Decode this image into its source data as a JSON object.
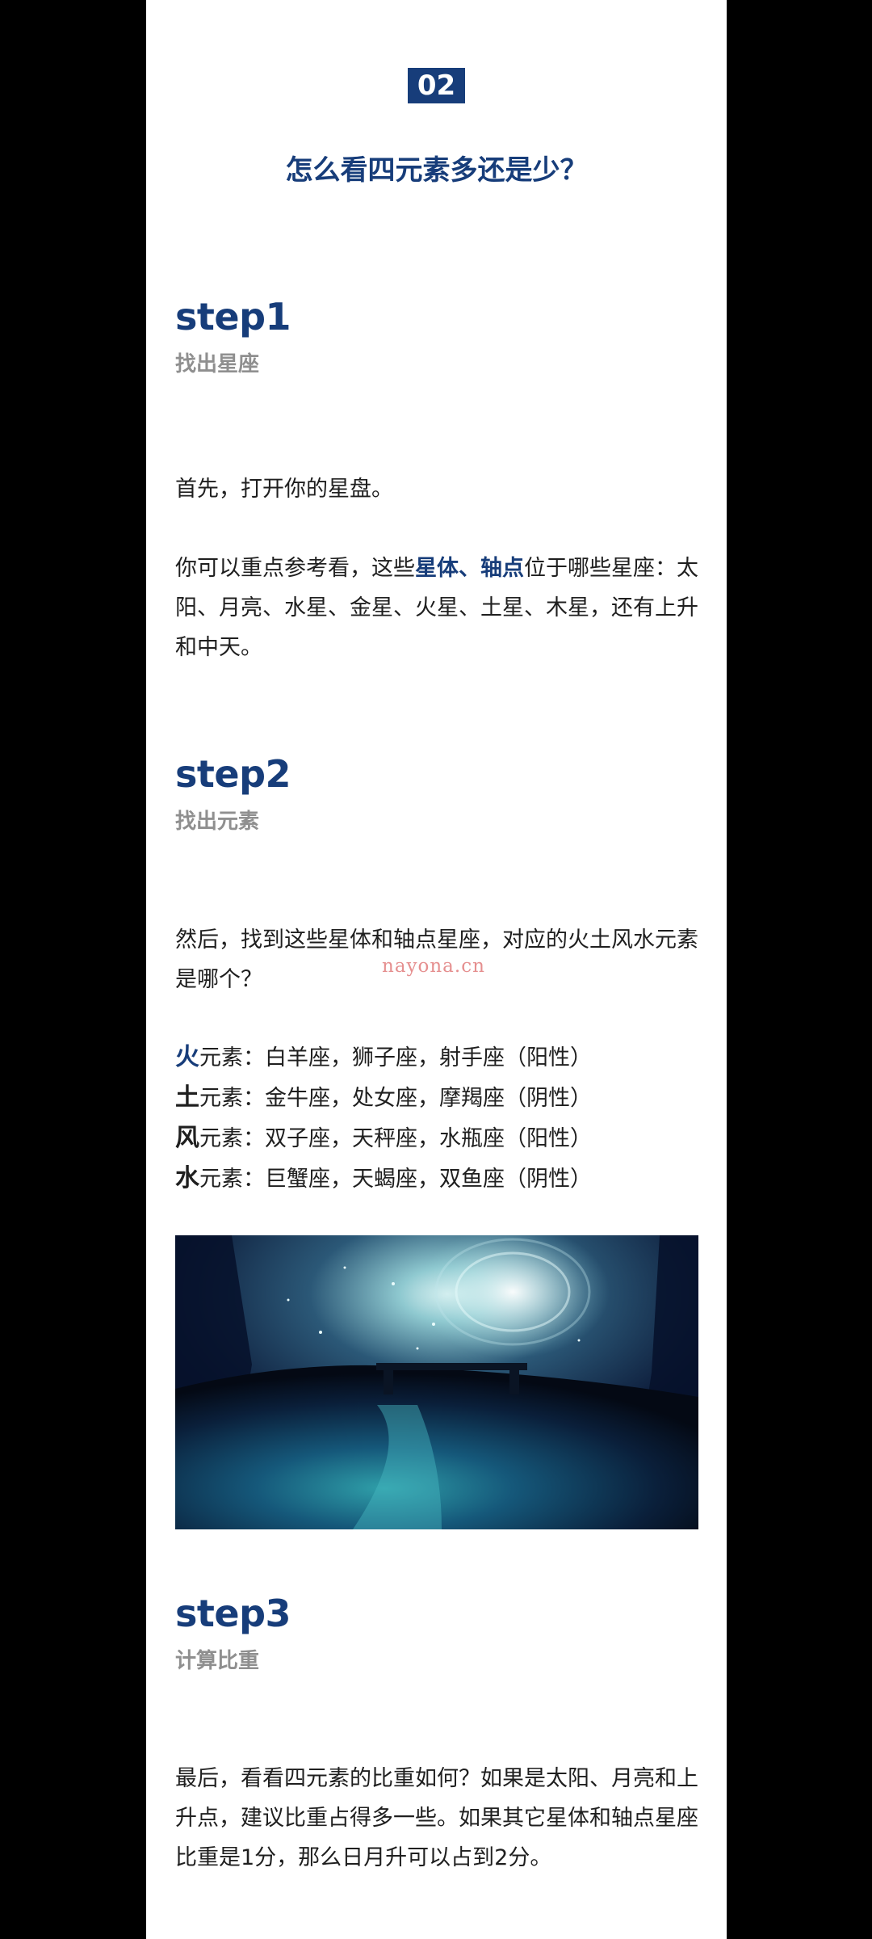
{
  "section": {
    "badge": "02",
    "title": "怎么看四元素多还是少？"
  },
  "step1": {
    "heading": "step1",
    "subtitle": "找出星座",
    "para1": "首先，打开你的星盘。",
    "para2_before": "你可以重点参考看，这些",
    "para2_highlight": "星体、轴点",
    "para2_after": "位于哪些星座：太阳、月亮、水星、金星、火星、土星、木星，还有上升和中天。"
  },
  "step2": {
    "heading": "step2",
    "subtitle": "找出元素",
    "para1": "然后，找到这些星体和轴点星座，对应的火土风水元素是哪个？",
    "elements": [
      {
        "key": "火",
        "text": "元素：白羊座，狮子座，射手座（阳性）"
      },
      {
        "key": "土",
        "text": "元素：金牛座，处女座，摩羯座（阴性）"
      },
      {
        "key": "风",
        "text": "元素：双子座，天秤座，水瓶座（阳性）"
      },
      {
        "key": "水",
        "text": "元素：巨蟹座，天蝎座，双鱼座（阴性）"
      }
    ]
  },
  "watermark": "nayona.cn",
  "image": {
    "description_icon": "moonlit-forest-bench-image"
  },
  "step3": {
    "heading": "step3",
    "subtitle": "计算比重",
    "para1": "最后，看看四元素的比重如何？如果是太阳、月亮和上升点，建议比重占得多一些。如果其它星体和轴点星座比重是1分，那么日月升可以占到2分。"
  },
  "colors": {
    "accent": "#173d7a",
    "subtitle": "#8f8f8f",
    "body_text": "#1f1f1f",
    "watermark": "#e58f8f",
    "background_outer": "#000000",
    "background_page": "#ffffff"
  }
}
